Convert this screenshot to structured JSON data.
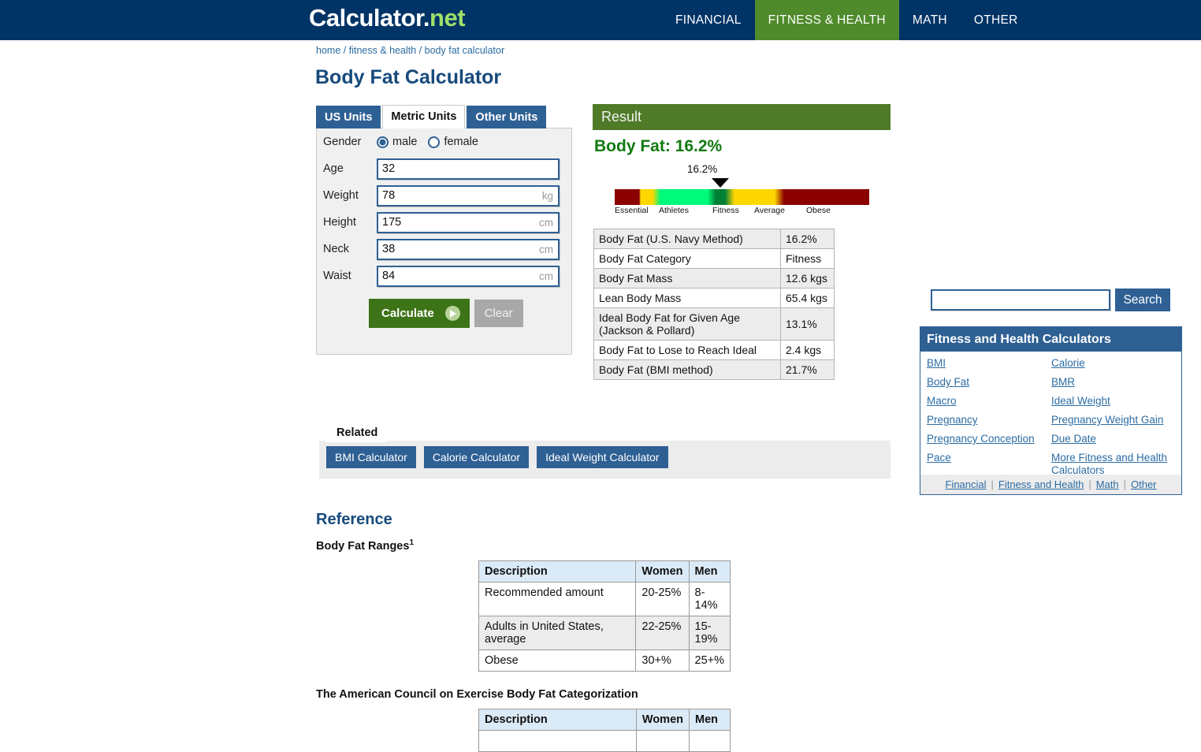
{
  "header": {
    "logo_main": "Calculator",
    "logo_dot": ".",
    "logo_net": "net",
    "nav": [
      {
        "label": "FINANCIAL",
        "active": false
      },
      {
        "label": "FITNESS & HEALTH",
        "active": true
      },
      {
        "label": "MATH",
        "active": false
      },
      {
        "label": "OTHER",
        "active": false
      }
    ]
  },
  "breadcrumb": {
    "home": "home",
    "category": "fitness & health",
    "current": "body fat calculator",
    "separator": "/"
  },
  "page_title": "Body Fat Calculator",
  "tabs": [
    {
      "label": "US Units",
      "active": false
    },
    {
      "label": "Metric Units",
      "active": true
    },
    {
      "label": "Other Units",
      "active": false
    }
  ],
  "form": {
    "gender": {
      "label": "Gender",
      "male": "male",
      "female": "female",
      "selected": "male"
    },
    "fields": [
      {
        "label": "Age",
        "value": "32",
        "unit": "",
        "placeholder": ""
      },
      {
        "label": "Weight",
        "value": "78",
        "unit": "kg",
        "placeholder": ""
      },
      {
        "label": "Height",
        "value": "175",
        "unit": "cm",
        "placeholder": ""
      },
      {
        "label": "Neck",
        "value": "38",
        "unit": "cm",
        "placeholder": ""
      },
      {
        "label": "Waist",
        "value": "84",
        "unit": "cm",
        "placeholder": ""
      }
    ],
    "calculate_label": "Calculate",
    "clear_label": "Clear"
  },
  "result": {
    "header": "Result",
    "headline": "Body Fat: 16.2%",
    "gauge": {
      "value_label": "16.2%",
      "segments": [
        {
          "name": "Essential",
          "color": "#8b0000"
        },
        {
          "name": "Athletes",
          "color": "#00fa7a"
        },
        {
          "name": "Fitness",
          "color": "#008035"
        },
        {
          "name": "Average",
          "color": "#ffd700"
        },
        {
          "name": "Obese",
          "color": "#8b0000"
        }
      ]
    },
    "rows": [
      {
        "key": "Body Fat (U.S. Navy Method)",
        "value": "16.2%"
      },
      {
        "key": "Body Fat Category",
        "value": "Fitness"
      },
      {
        "key": "Body Fat Mass",
        "value": "12.6 kgs"
      },
      {
        "key": "Lean Body Mass",
        "value": "65.4 kgs"
      },
      {
        "key": "Ideal Body Fat for Given Age (Jackson & Pollard)",
        "value": "13.1%"
      },
      {
        "key": "Body Fat to Lose to Reach Ideal",
        "value": "2.4 kgs"
      },
      {
        "key": "Body Fat (BMI method)",
        "value": "21.7%"
      }
    ]
  },
  "related": {
    "tab_label": "Related",
    "buttons": [
      "BMI Calculator",
      "Calorie Calculator",
      "Ideal Weight Calculator"
    ]
  },
  "reference": {
    "heading": "Reference",
    "table1": {
      "title": "Body Fat Ranges",
      "title_sup": "1",
      "headers": [
        "Description",
        "Women",
        "Men"
      ],
      "rows": [
        [
          "Recommended amount",
          "20-25%",
          "8-14%"
        ],
        [
          "Adults in United States, average",
          "22-25%",
          "15-19%"
        ],
        [
          "Obese",
          "30+%",
          "25+%"
        ]
      ]
    },
    "table2": {
      "title": "The American Council on Exercise Body Fat Categorization",
      "headers": [
        "Description",
        "Women",
        "Men"
      ]
    }
  },
  "sidebar": {
    "search": {
      "value": "",
      "placeholder": "",
      "button": "Search"
    },
    "box_title": "Fitness and Health Calculators",
    "links": [
      "BMI",
      "Calorie",
      "Body Fat",
      "BMR",
      "Macro",
      "Ideal Weight",
      "Pregnancy",
      "Pregnancy Weight Gain",
      "Pregnancy Conception",
      "Due Date",
      "Pace",
      "More Fitness and Health Calculators"
    ],
    "footer_links": [
      "Financial",
      "Fitness and Health",
      "Math",
      "Other"
    ],
    "footer_sep": "|"
  },
  "colors": {
    "navy": "#003366",
    "green_accent": "#4f8a2b",
    "link_blue": "#2b6ca3",
    "title_blue": "#174a7c",
    "result_green": "#117a11"
  }
}
